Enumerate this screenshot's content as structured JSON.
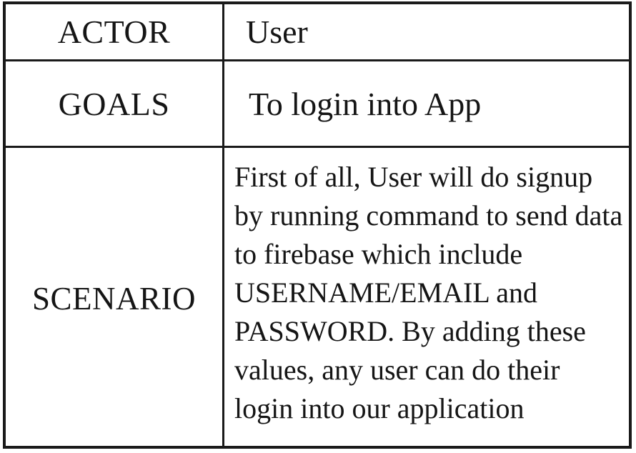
{
  "table": {
    "rows": [
      {
        "label": "ACTOR",
        "value": "User"
      },
      {
        "label": "GOALS",
        "value": "To login into App"
      },
      {
        "label": "SCENARIO",
        "value": "First of all, User will do signup by running command to send data to firebase which include USERNAME/EMAIL and PASSWORD. By adding these values, any user can do their login into our application"
      }
    ]
  }
}
